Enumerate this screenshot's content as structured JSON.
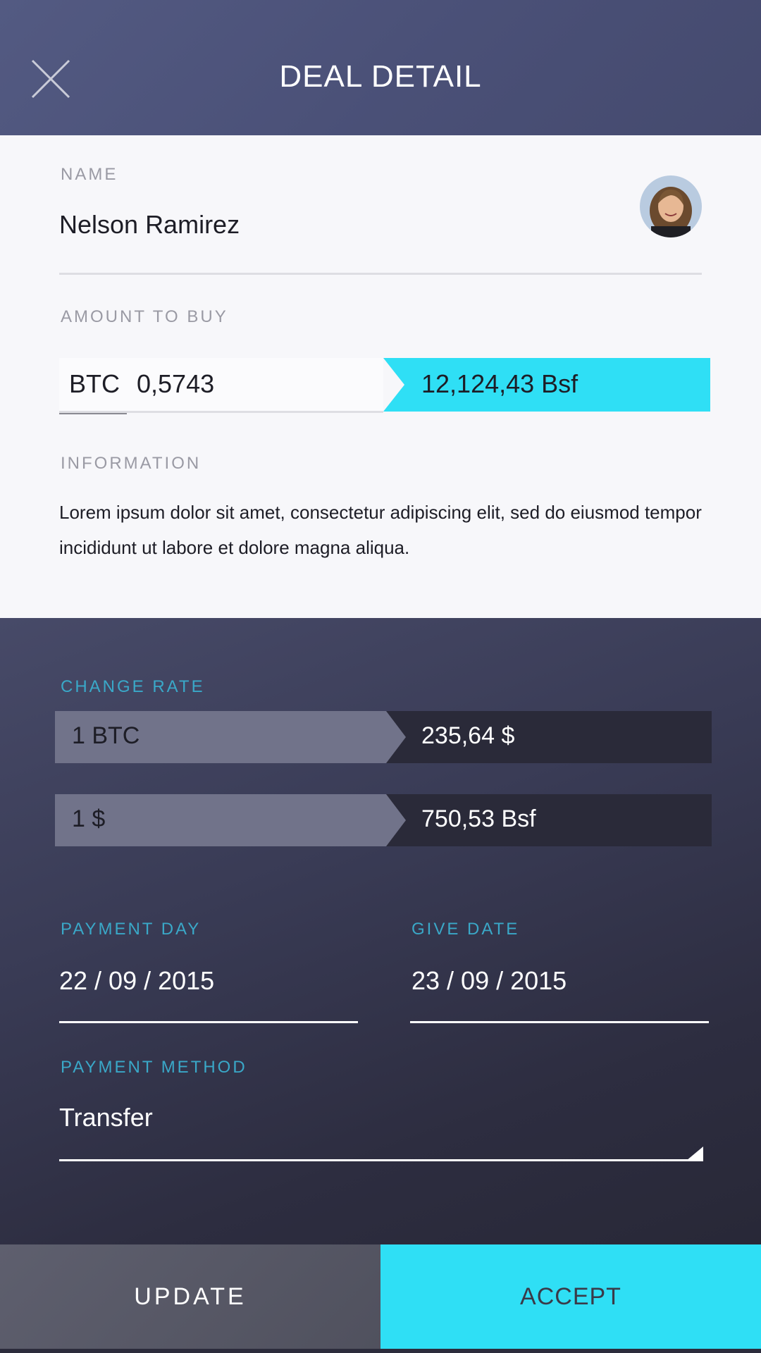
{
  "header": {
    "title": "DEAL DETAIL",
    "close_icon": "close-icon"
  },
  "name_section": {
    "label": "NAME",
    "value": "Nelson Ramirez"
  },
  "amount": {
    "label": "AMOUNT TO BUY",
    "currency": "BTC",
    "value": "0,5743",
    "converted": "12,124,43 Bsf"
  },
  "information": {
    "label": "INFORMATION",
    "text": "Lorem ipsum dolor sit amet, consectetur adipiscing elit, sed do eiusmod tempor incididunt ut labore et dolore magna aliqua."
  },
  "change_rate": {
    "label": "CHANGE RATE",
    "rows": [
      {
        "from": "1 BTC",
        "to": "235,64 $"
      },
      {
        "from": "1 $",
        "to": "750,53 Bsf"
      }
    ]
  },
  "payment_day": {
    "label": "PAYMENT DAY",
    "value": "22 / 09 / 2015"
  },
  "give_date": {
    "label": "GIVE DATE",
    "value": "23 / 09 / 2015"
  },
  "payment_method": {
    "label": "PAYMENT METHOD",
    "value": "Transfer"
  },
  "buttons": {
    "update": "UPDATE",
    "accept": "ACCEPT"
  },
  "colors": {
    "accent": "#2fdff5",
    "label_blue": "#3aa8c8",
    "header_bg": "#4a5077",
    "dark_bg": "#2d2d40"
  }
}
